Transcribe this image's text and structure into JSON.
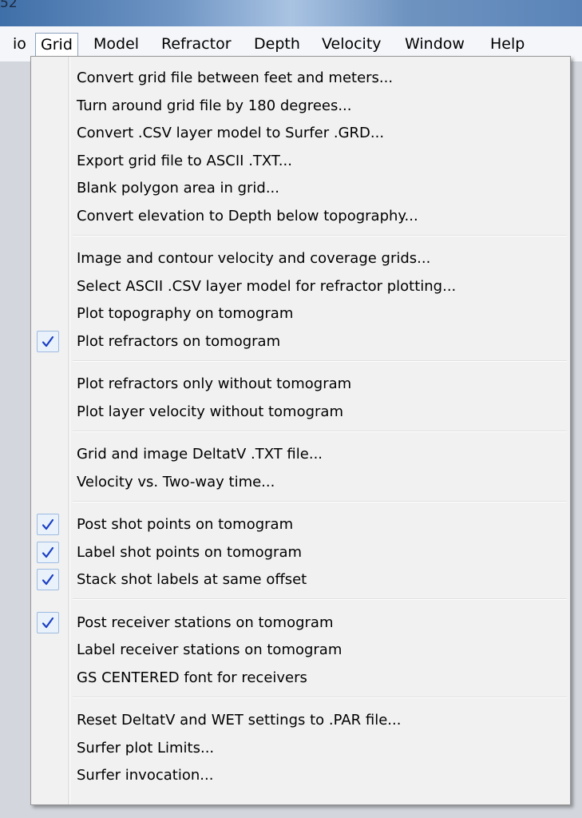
{
  "window": {
    "title_fragment": "52"
  },
  "menubar": [
    {
      "label": "io"
    },
    {
      "label": "Grid",
      "active": true
    },
    {
      "label": "Model"
    },
    {
      "label": "Refractor"
    },
    {
      "label": "Depth"
    },
    {
      "label": "Velocity"
    },
    {
      "label": "Window"
    },
    {
      "label": "Help"
    }
  ],
  "grid_menu": {
    "groups": [
      [
        {
          "label": "Convert grid file between feet and meters...",
          "checked": false
        },
        {
          "label": "Turn around grid file by 180 degrees...",
          "checked": false
        },
        {
          "label": "Convert .CSV layer model to Surfer .GRD...",
          "checked": false
        },
        {
          "label": "Export grid file to ASCII .TXT...",
          "checked": false
        },
        {
          "label": "Blank polygon area in grid...",
          "checked": false
        },
        {
          "label": "Convert elevation to Depth below topography...",
          "checked": false
        }
      ],
      [
        {
          "label": "Image and contour velocity and coverage grids...",
          "checked": false
        },
        {
          "label": "Select ASCII .CSV layer model for refractor plotting...",
          "checked": false
        },
        {
          "label": "Plot topography on tomogram",
          "checked": false
        },
        {
          "label": "Plot refractors on tomogram",
          "checked": true
        }
      ],
      [
        {
          "label": "Plot refractors only without tomogram",
          "checked": false
        },
        {
          "label": "Plot layer velocity without tomogram",
          "checked": false
        }
      ],
      [
        {
          "label": "Grid and image DeltatV .TXT file...",
          "checked": false
        },
        {
          "label": "Velocity vs. Two-way time...",
          "checked": false
        }
      ],
      [
        {
          "label": "Post shot points on tomogram",
          "checked": true
        },
        {
          "label": "Label shot points on tomogram",
          "checked": true
        },
        {
          "label": "Stack shot labels at same offset",
          "checked": true
        }
      ],
      [
        {
          "label": "Post receiver stations on tomogram",
          "checked": true
        },
        {
          "label": "Label receiver stations on tomogram",
          "checked": false
        },
        {
          "label": "GS CENTERED font for receivers",
          "checked": false
        }
      ],
      [
        {
          "label": "Reset DeltatV and WET settings to .PAR file...",
          "checked": false
        },
        {
          "label": "Surfer plot Limits...",
          "checked": false
        },
        {
          "label": "Surfer invocation...",
          "checked": false
        }
      ]
    ]
  },
  "colors": {
    "check": "#1a3fc4",
    "menu_bg": "#f1f1f1",
    "active_border": "#8aa0bd"
  }
}
